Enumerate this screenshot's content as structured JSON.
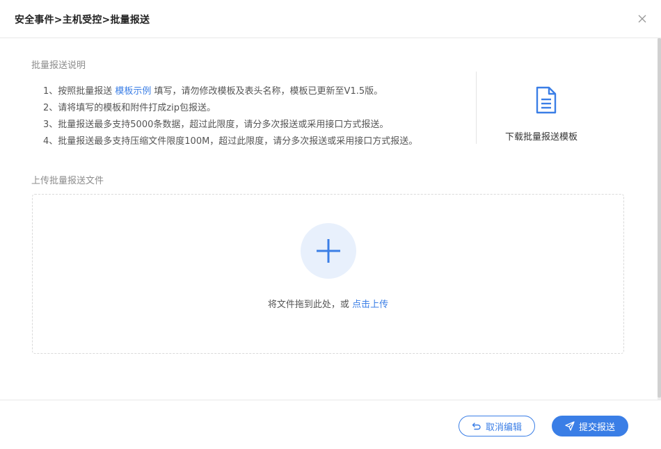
{
  "dialog": {
    "title": "安全事件>主机受控>批量报送"
  },
  "description": {
    "section_title": "批量报送说明",
    "items": [
      {
        "prefix": "1、按照批量报送 ",
        "link": "模板示例",
        "suffix": " 填写，请勿修改模板及表头名称，模板已更新至V1.5版。"
      },
      {
        "text": "2、请将填写的模板和附件打成zip包报送。"
      },
      {
        "text": "3、批量报送最多支持5000条数据，超过此限度，请分多次报送或采用接口方式报送。"
      },
      {
        "text": "4、批量报送最多支持压缩文件限度100M，超过此限度，请分多次报送或采用接口方式报送。"
      }
    ]
  },
  "download": {
    "label": "下载批量报送模板",
    "icon": "document-icon"
  },
  "upload": {
    "section_title": "上传批量报送文件",
    "drop_text": "将文件拖到此处，或 ",
    "click_text": "点击上传",
    "icon": "plus-icon"
  },
  "footer": {
    "cancel_label": "取消编辑",
    "submit_label": "提交报送"
  },
  "colors": {
    "accent": "#3a7ee6",
    "plus_circle_bg": "#e8f0fc"
  }
}
